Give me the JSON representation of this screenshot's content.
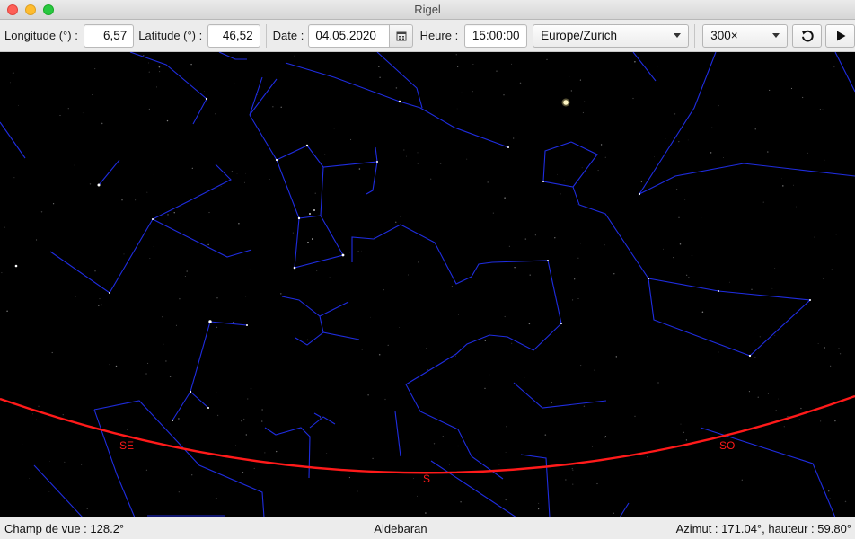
{
  "window": {
    "title": "Rigel"
  },
  "toolbar": {
    "longitude_label": "Longitude (°) :",
    "longitude_value": "6,57",
    "latitude_label": "Latitude (°) :",
    "latitude_value": "46,52",
    "date_label": "Date :",
    "date_value": "04.05.2020",
    "time_label": "Heure :",
    "time_value": "15:00:00",
    "timezone_value": "Europe/Zurich",
    "speed_value": "300×",
    "reset_icon": "reset-icon",
    "play_icon": "play-icon",
    "calendar_icon": "calendar-icon"
  },
  "sky": {
    "horizon_color": "#ff1a1a",
    "line_color": "#1f2de0",
    "cardinal_se": "SE",
    "cardinal_s": "S",
    "cardinal_so": "SO"
  },
  "status": {
    "field_of_view": "Champ de vue : 128.2°",
    "object_under_cursor": "Aldebaran",
    "position": "Azimut : 171.04°, hauteur : 59.80°"
  }
}
